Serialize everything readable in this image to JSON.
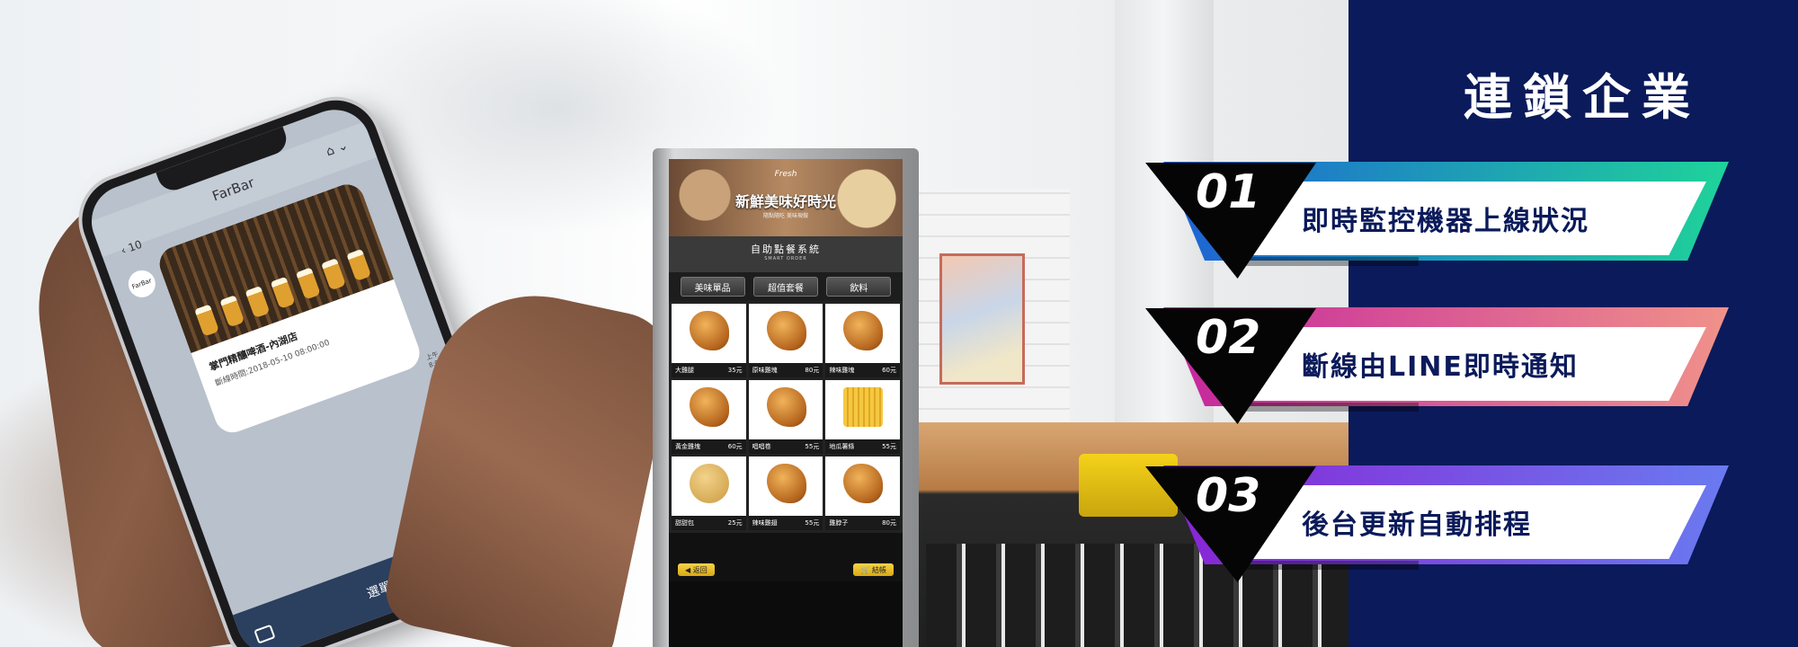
{
  "phone": {
    "app_name": "FarBar",
    "back_count": "10",
    "avatar_text": "FarBar",
    "card_title": "掌門精釀啤酒-內湖店",
    "card_subtitle": "斷線時間:2018-05-10 08:00:00",
    "time_label": "上午8:00",
    "bottom_label": "選單"
  },
  "kiosk": {
    "logo": "Fresh",
    "banner_title": "新鮮美味好時光",
    "banner_subtitle": "隨點隨吃 美味現做",
    "system_title": "自助點餐系統",
    "system_subtitle": "SMART ORDER",
    "tabs": [
      "美味單品",
      "超值套餐",
      "飲料"
    ],
    "items": [
      {
        "name": "大雞腿",
        "price": "35元"
      },
      {
        "name": "原味雞塊",
        "price": "80元"
      },
      {
        "name": "辣味雞塊",
        "price": "60元"
      },
      {
        "name": "黃金雞塊",
        "price": "60元"
      },
      {
        "name": "唱唱卷",
        "price": "55元"
      },
      {
        "name": "地瓜薯條",
        "price": "55元"
      },
      {
        "name": "甜甜包",
        "price": "25元"
      },
      {
        "name": "辣味雞翅",
        "price": "55元"
      },
      {
        "name": "雞脖子",
        "price": "80元"
      }
    ],
    "back_button": "返回",
    "checkout_button": "結帳"
  },
  "panel": {
    "title": "連鎖企業",
    "features": [
      {
        "number": "01",
        "text": "即時監控機器上線狀況"
      },
      {
        "number": "02",
        "text": "斷線由LINE即時通知"
      },
      {
        "number": "03",
        "text": "後台更新自動排程"
      }
    ]
  },
  "colors": {
    "panel_bg": "#0b1a5a",
    "ribbon1": [
      "#1e5bd8",
      "#1fd39a"
    ],
    "ribbon2": [
      "#c21f9e",
      "#f0928a"
    ],
    "ribbon3": [
      "#8a1fd4",
      "#6a7af0"
    ]
  }
}
